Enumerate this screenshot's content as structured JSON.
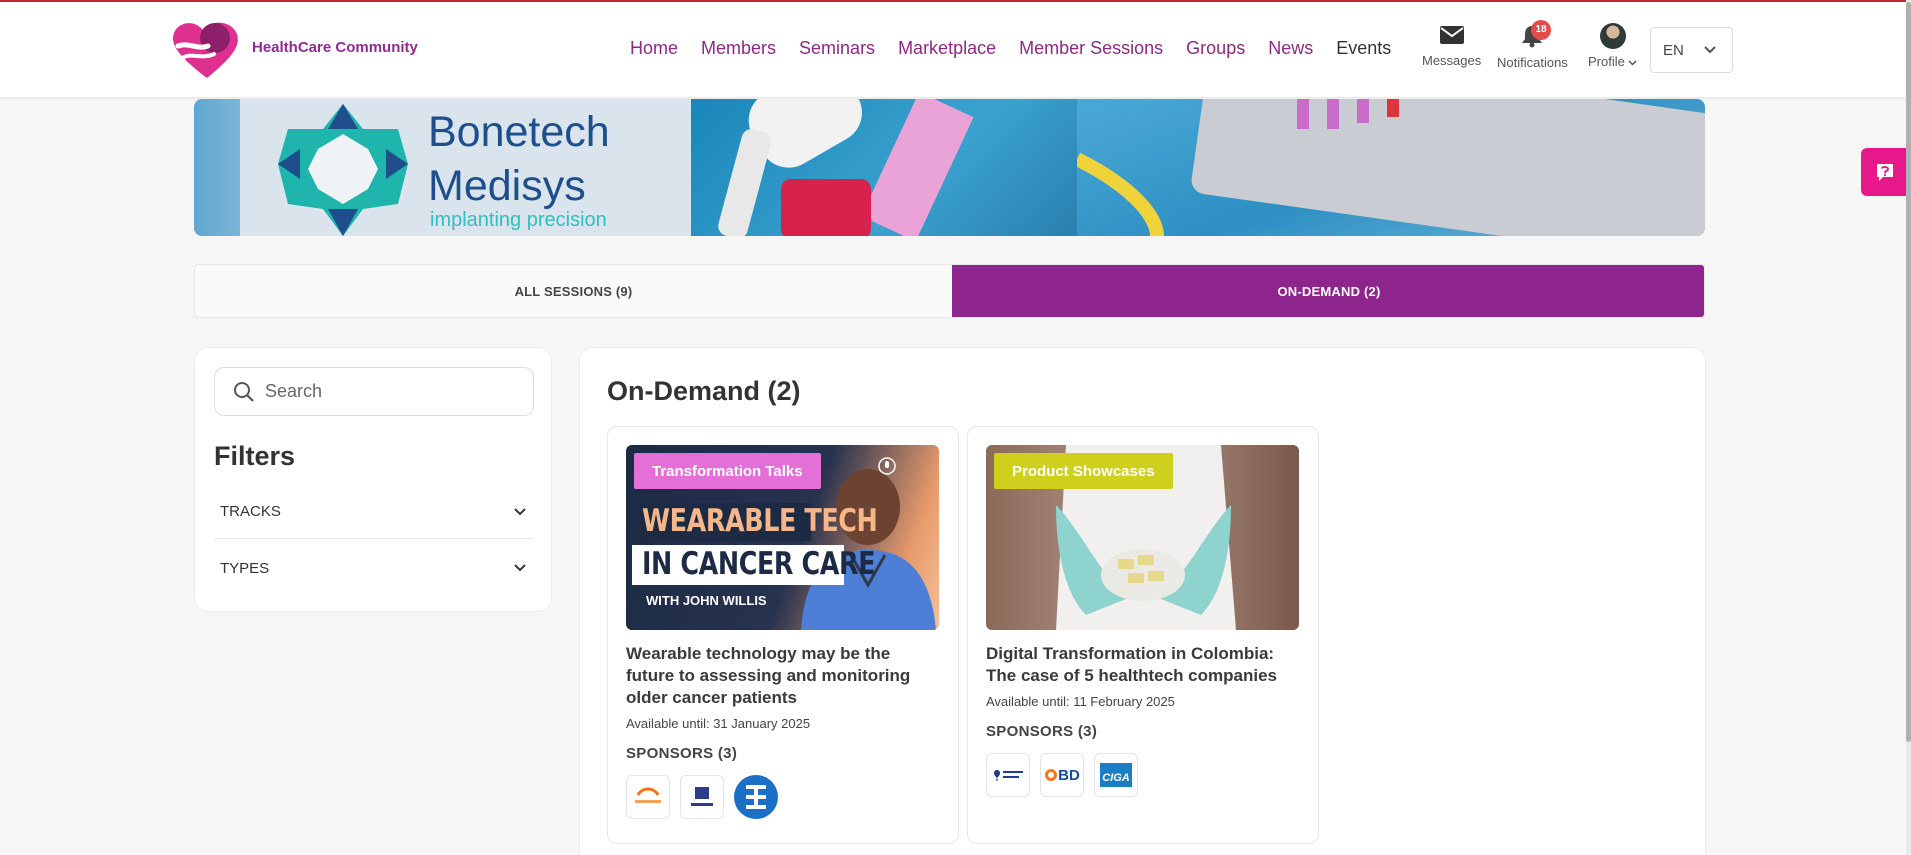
{
  "header": {
    "logo_text": "HealthCare Community",
    "nav": [
      "Home",
      "Members",
      "Seminars",
      "Marketplace",
      "Member Sessions",
      "Groups",
      "News",
      "Events"
    ],
    "messages_label": "Messages",
    "notifications_label": "Notifications",
    "notifications_count": "18",
    "profile_label": "Profile",
    "language": "EN"
  },
  "banner": {
    "brand_line1": "Bonetech",
    "brand_line2": "Medisys",
    "tagline": "implanting precision"
  },
  "tabs": {
    "all": "ALL SESSIONS (9)",
    "on_demand": "ON-DEMAND (2)"
  },
  "sidebar": {
    "search_placeholder": "Search",
    "filters_title": "Filters",
    "filter_tracks": "TRACKS",
    "filter_types": "TYPES"
  },
  "main": {
    "title": "On-Demand (2)",
    "cards": [
      {
        "tag": "Transformation Talks",
        "tag_color": "#e46fd6",
        "thumb_line1": "WEARABLE TECH",
        "thumb_line2": "IN CANCER CARE",
        "thumb_line3": "WITH JOHN WILLIS",
        "title": "Wearable technology may be the future to assessing and monitoring older cancer patients",
        "available": "Available until: 31 January 2025",
        "sponsors": "SPONSORS (3)"
      },
      {
        "tag": "Product Showcases",
        "tag_color": "#cfcf1e",
        "title": "Digital Transformation in Colombia: The case of 5 healthtech companies",
        "available": "Available until: 11 February 2025",
        "sponsors": "SPONSORS (3)",
        "logo_bd": "BD",
        "logo_ciga": "CIGA"
      }
    ]
  },
  "colors": {
    "accent": "#8e258c",
    "help": "#e6188a"
  }
}
